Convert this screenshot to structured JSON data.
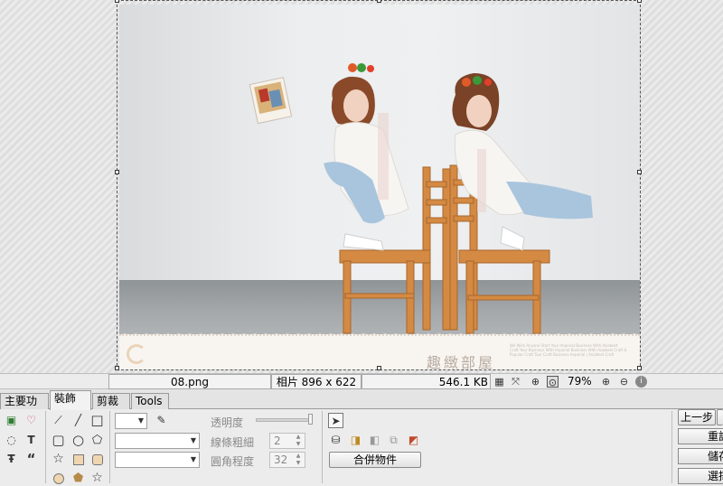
{
  "canvas": {
    "image_alt": "photo of two women in white dresses sitting back-to-back on wooden chairs",
    "watermark": "趣緻部屋",
    "watermark_small": "We Wish Anyone Start Your Imperial Business With Asiabest Craft Your Business With Imperial Business With Asiabest Craft & Popular Craft Tour Craft Business Imperial | Asiabest Craft"
  },
  "statusbar": {
    "filename": "08.png",
    "dimensions": "相片 896 x 622",
    "filesize": "546.1 KB",
    "zoom": "79%",
    "icons": [
      "checker-icon",
      "fit-icon",
      "zoom-actual-icon",
      "zoom-fit-icon",
      "zoom-in-icon",
      "zoom-out-icon",
      "info-icon"
    ]
  },
  "tabs": [
    {
      "label": "主要功能",
      "active": false
    },
    {
      "label": "裝飾",
      "active": true
    },
    {
      "label": "剪裁",
      "active": false
    },
    {
      "label": "Tools",
      "active": false
    }
  ],
  "tools": {
    "insert_icons": [
      "image-icon",
      "heart-stamp-icon",
      "speech-bubble-icon",
      "text-icon",
      "text-path-icon",
      "quote-icon"
    ],
    "shape_icons": [
      "magic-wand-icon",
      "line-icon",
      "rectangle-icon",
      "rounded-rect-icon",
      "circle-icon",
      "pentagon-icon",
      "star-icon",
      "filled-rect-icon",
      "filled-rounded-rect-icon",
      "filled-circle-icon",
      "filled-pentagon-icon",
      "outline-star-icon"
    ],
    "opacity_label": "透明度",
    "line_width_label": "線條粗細",
    "line_width_value": "2",
    "corner_label": "圓角程度",
    "corner_value": "32",
    "merge_button": "合併物件",
    "object_icons": [
      "pointer-icon",
      "bucket-icon",
      "bring-front-icon",
      "send-back-icon",
      "group-icon",
      "recolor-icon"
    ]
  },
  "side_buttons": {
    "undo": "上一步",
    "redo": "重設",
    "save": "儲存",
    "select": "選擇"
  },
  "colors": {
    "canvas_bg": "#e3e3e3",
    "panel_bg": "#ececec"
  }
}
